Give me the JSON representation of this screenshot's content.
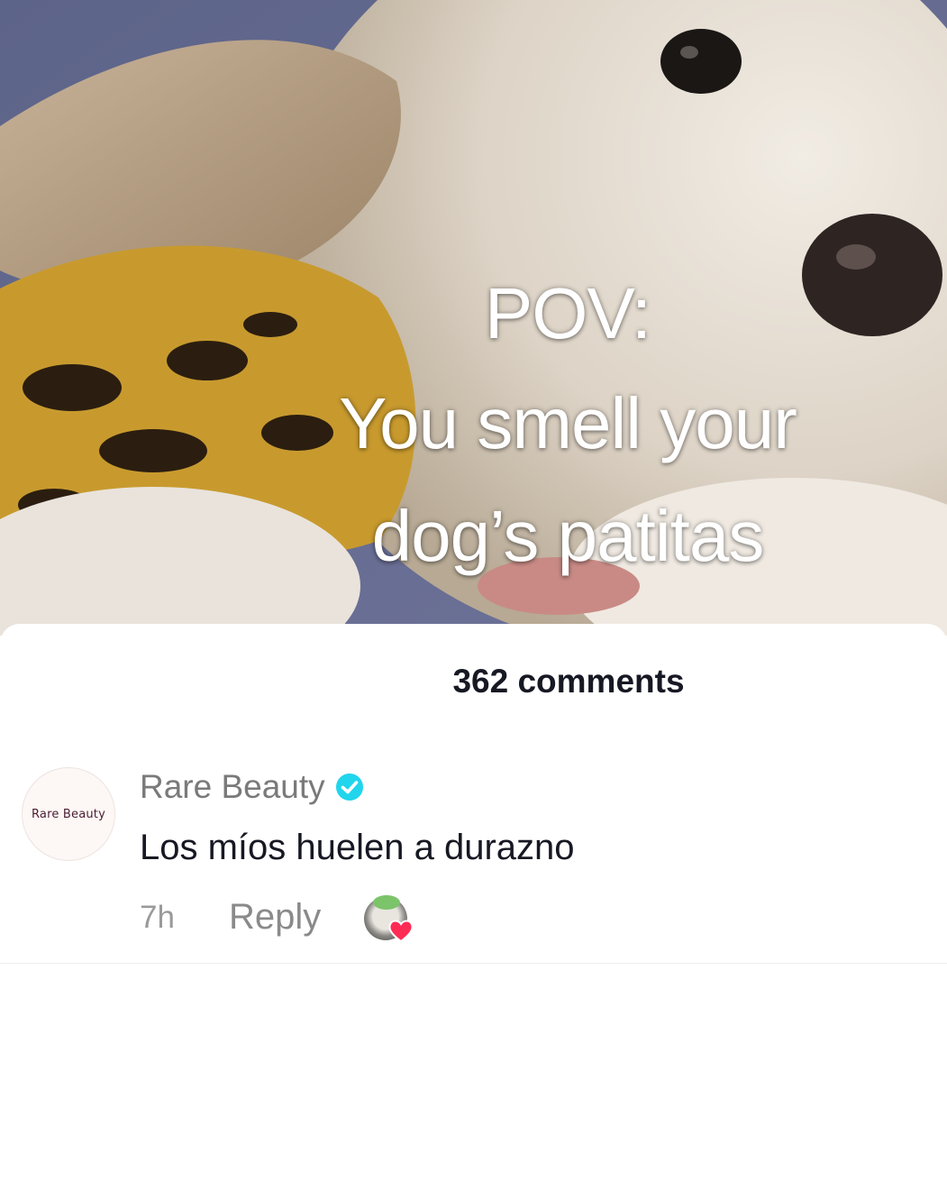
{
  "video": {
    "overlay_line1": "POV:",
    "overlay_line2": "You smell your",
    "overlay_line3": "dog’s patitas"
  },
  "comments": {
    "count_label": "362 comments",
    "items": [
      {
        "avatar_text": "Rare Beauty",
        "username": "Rare Beauty",
        "verified": true,
        "text": "Los míos huelen a durazno",
        "time": "7h",
        "reply_label": "Reply"
      }
    ]
  },
  "colors": {
    "verified_badge": "#20d5ec",
    "heart": "#fe2c55",
    "text_primary": "#161823",
    "text_secondary": "#8a8a8a"
  },
  "icons": [
    "verified-badge-icon",
    "heart-icon"
  ]
}
